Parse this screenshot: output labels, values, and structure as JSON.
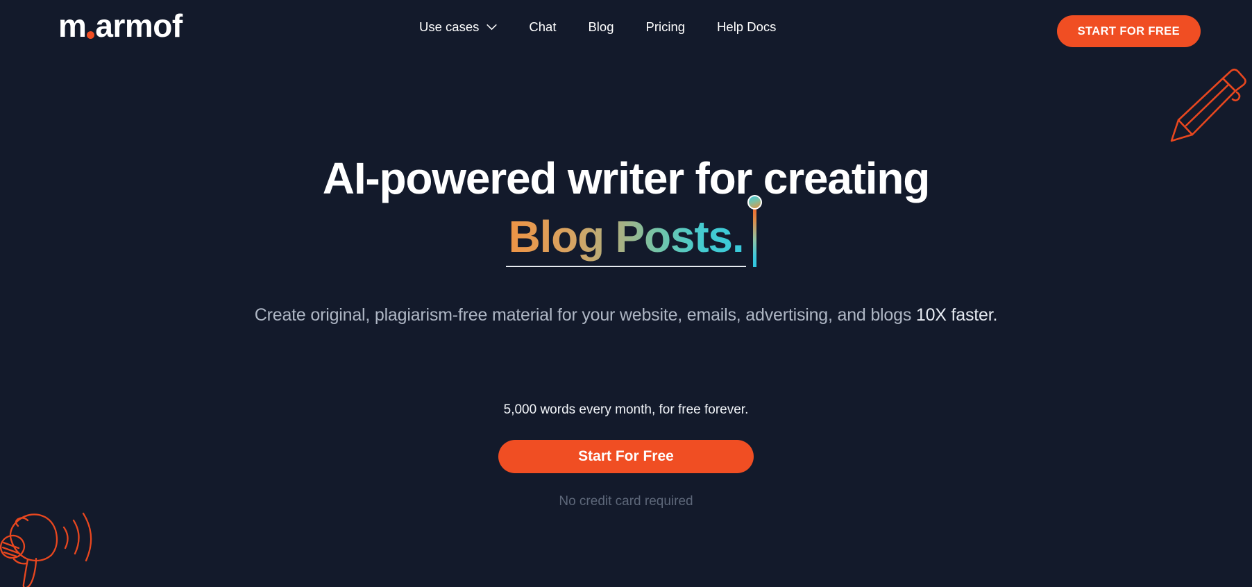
{
  "brand": {
    "name_part1": "m",
    "dot": "dot-accent",
    "name_part2": "armof",
    "accent_color": "#f04e23"
  },
  "nav": {
    "items": [
      {
        "label": "Use cases",
        "has_dropdown": true,
        "icon": "chevron-down-icon"
      },
      {
        "label": "Chat",
        "has_dropdown": false
      },
      {
        "label": "Blog",
        "has_dropdown": false
      },
      {
        "label": "Pricing",
        "has_dropdown": false
      },
      {
        "label": "Help Docs",
        "has_dropdown": false
      }
    ],
    "cta_label": "START FOR FREE"
  },
  "hero": {
    "headline": "AI-powered writer for creating",
    "gradient_word": "Blog Posts.",
    "gradient_from": "#ef9344",
    "gradient_to": "#38c9db",
    "subtitle_lead": "Create original, plagiarism-free material for your website, emails, advertising, and blogs ",
    "subtitle_strong": "10X faster.",
    "offer_text": "5,000 words every month, for free forever.",
    "cta_label": "Start For Free",
    "note": "No credit card required"
  },
  "decorations": {
    "pencil": "pencil-icon",
    "megaphone": "megaphone-icon",
    "outline_color": "#e8471f"
  },
  "theme": {
    "background": "#131a2b",
    "accent": "#f04e23",
    "text_primary": "#ffffff",
    "text_muted": "#aeb6c4",
    "text_dim": "#5d6779"
  }
}
